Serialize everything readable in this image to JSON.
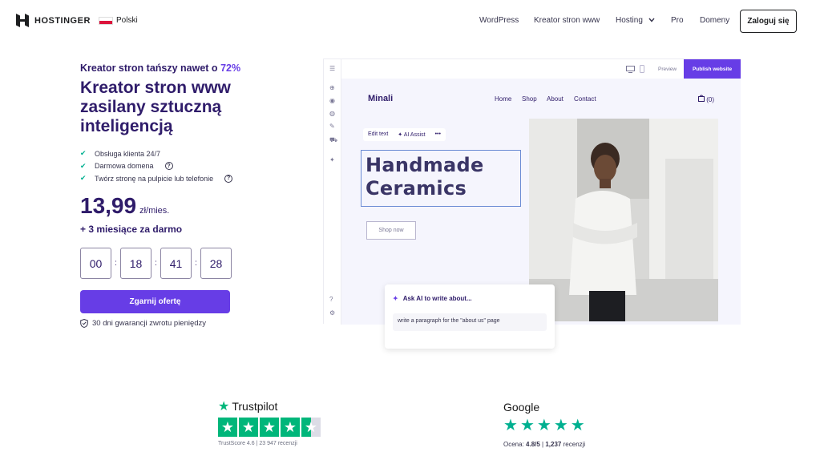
{
  "header": {
    "logo_text": "HOSTINGER",
    "language": "Polski",
    "nav": [
      "WordPress",
      "Kreator stron www",
      "Hosting",
      "Pro",
      "Domeny"
    ],
    "login": "Zaloguj się"
  },
  "hero": {
    "promo_text": "Kreator stron tańszy nawet o",
    "promo_highlight": "72%",
    "title": "Kreator stron www zasilany sztuczną inteligencją",
    "features": [
      "Obsługa klienta 24/7",
      "Darmowa domena",
      "Twórz stronę na pulpicie lub telefonie"
    ],
    "price": "13,99",
    "price_unit": "zł/mies.",
    "bonus": "+ 3 miesiące za darmo",
    "timer": [
      "00",
      "18",
      "41",
      "28"
    ],
    "cta": "Zgarnij ofertę",
    "guarantee": "30 dni gwarancji zwrotu pieniędzy"
  },
  "editor": {
    "preview": "Preview",
    "publish": "Publish website",
    "site_logo": "Minali",
    "site_nav": [
      "Home",
      "Shop",
      "About",
      "Contact"
    ],
    "cart": "(0)",
    "toolbar": [
      "Edit text",
      "AI Assist",
      "•••"
    ],
    "headline": [
      "Handmade",
      "Ceramics"
    ],
    "shop_button": "Shop now",
    "ai_title": "Ask AI to write about...",
    "ai_input": "write a paragraph for the \"about us\" page"
  },
  "ratings": {
    "trustpilot": {
      "name": "Trustpilot",
      "score_text": "TrustScore 4.6 | 23 947 recenzji",
      "stars": 4.5
    },
    "google": {
      "name": "Google",
      "score_label": "Ocena:",
      "score": "4.8/5",
      "sep": " | ",
      "count": "1,237",
      "count_label": "recenzji",
      "stars": 5
    }
  },
  "colors": {
    "brand": "#673de6",
    "heading": "#2f1c6a",
    "trustpilot_green": "#00b67a",
    "check_green": "#00b090"
  }
}
